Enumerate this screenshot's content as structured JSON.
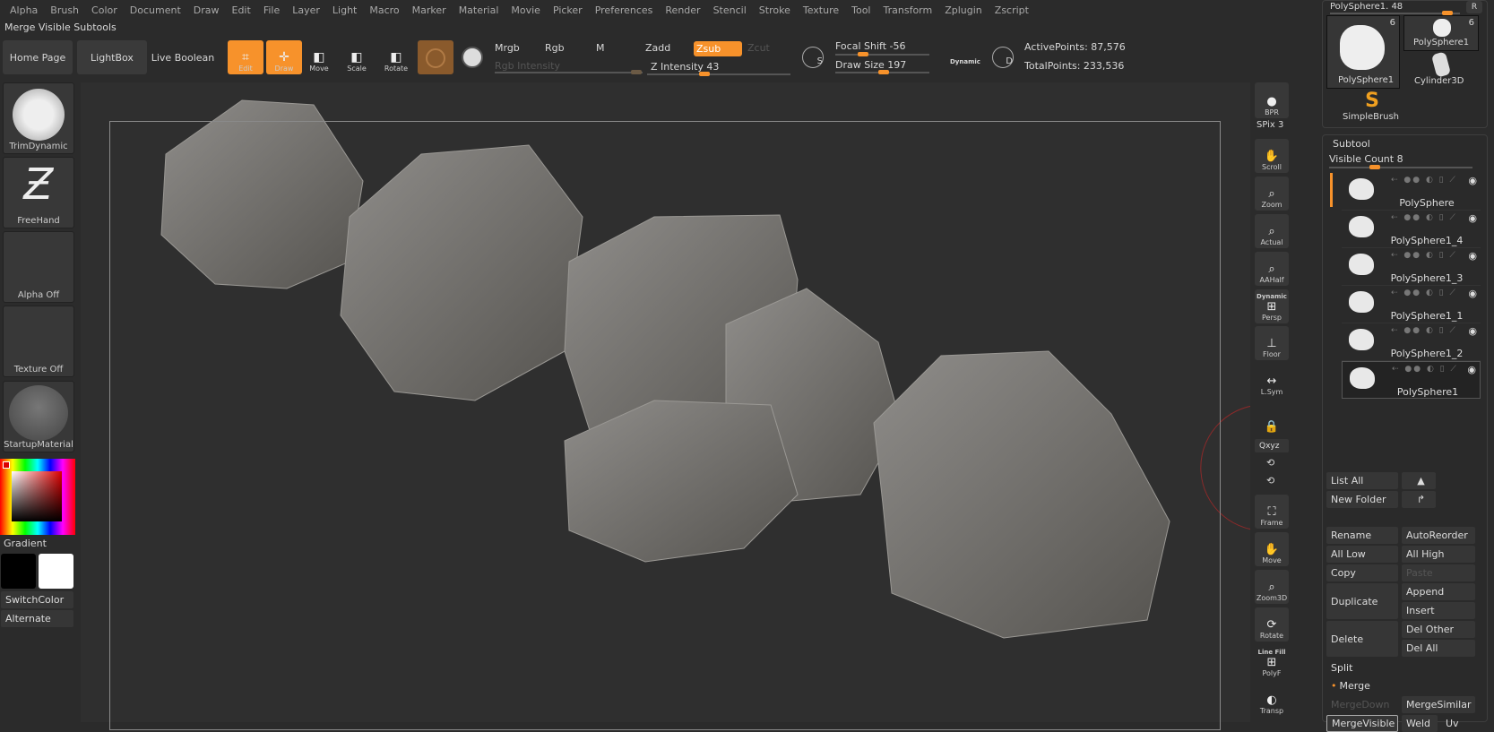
{
  "menu": [
    "Alpha",
    "Brush",
    "Color",
    "Document",
    "Draw",
    "Edit",
    "File",
    "Layer",
    "Light",
    "Macro",
    "Marker",
    "Material",
    "Movie",
    "Picker",
    "Preferences",
    "Render",
    "Stencil",
    "Stroke",
    "Texture",
    "Tool",
    "Transform",
    "Zplugin",
    "Zscript"
  ],
  "subpalette_title": "Merge Visible Subtools",
  "toolbar": {
    "home": "Home Page",
    "lightbox": "LightBox",
    "live_boolean": "Live Boolean",
    "edit": "Edit",
    "draw": "Draw",
    "move": "Move",
    "scale": "Scale",
    "rotate": "Rotate",
    "mrgb": "Mrgb",
    "rgb": "Rgb",
    "m": "M",
    "rgb_intensity": "Rgb Intensity",
    "zadd": "Zadd",
    "zsub": "Zsub",
    "zcut": "Zcut",
    "z_intensity": "Z Intensity 43",
    "z_intensity_value": 43,
    "focal_shift": "Focal Shift -56",
    "focal_shift_value": -56,
    "draw_size": "Draw Size 197",
    "draw_size_value": 197,
    "dynamic": "Dynamic",
    "s_label": "S",
    "d_label": "D",
    "active_points": "ActivePoints: 87,576",
    "total_points": "TotalPoints: 233,536"
  },
  "left_shelf": {
    "brush": "TrimDynamic",
    "stroke": "FreeHand",
    "alpha": "Alpha Off",
    "texture": "Texture Off",
    "material": "StartupMaterial",
    "gradient": "Gradient",
    "switch_color": "SwitchColor",
    "alternate": "Alternate",
    "main_color": "#000000",
    "secondary_color": "#ffffff"
  },
  "right_toolbar": {
    "bpr": "BPR",
    "spix": "SPix 3",
    "scroll": "Scroll",
    "zoom": "Zoom",
    "actual": "Actual",
    "aahalf": "AAHalf",
    "dynamic": "Dynamic",
    "persp": "Persp",
    "floor": "Floor",
    "lsym": "L.Sym",
    "qxyz": "Qxyz",
    "frame": "Frame",
    "move": "Move",
    "zoom3d": "Zoom3D",
    "rotate": "Rotate",
    "linefill": "Line Fill",
    "polyf": "PolyF",
    "transp": "Transp"
  },
  "tool_panel": {
    "slider": "PolySphere1. 48",
    "r": "R",
    "tools": [
      {
        "name": "PolySphere1",
        "count": "6"
      },
      {
        "name": "PolySphere1",
        "count": "6"
      },
      {
        "name": "Cylinder3D"
      },
      {
        "name": "SimpleBrush"
      }
    ]
  },
  "subtool": {
    "title": "Subtool",
    "visible_count": "Visible Count 8",
    "items": [
      "PolySphere",
      "PolySphere1_4",
      "PolySphere1_3",
      "PolySphere1_1",
      "PolySphere1_2",
      "PolySphere1"
    ],
    "buttons": {
      "list_all": "List All",
      "new_folder": "New Folder",
      "rename": "Rename",
      "auto_reorder": "AutoReorder",
      "all_low": "All Low",
      "all_high": "All High",
      "copy": "Copy",
      "paste": "Paste",
      "duplicate": "Duplicate",
      "append": "Append",
      "insert": "Insert",
      "delete": "Delete",
      "del_other": "Del Other",
      "del_all": "Del All",
      "split": "Split",
      "merge": "Merge",
      "merge_down": "MergeDown",
      "merge_similar": "MergeSimilar",
      "merge_visible": "MergeVisible",
      "weld": "Weld",
      "uv": "Uv"
    }
  },
  "colors": {
    "accent": "#f7922b",
    "background": "#2b2b2b"
  }
}
